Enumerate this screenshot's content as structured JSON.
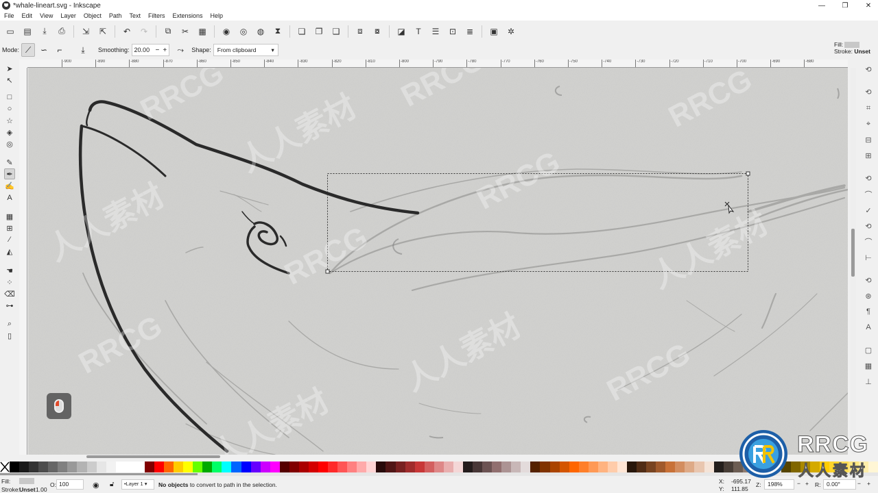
{
  "window": {
    "title": "*whale-lineart.svg - Inkscape",
    "min": "—",
    "max": "❐",
    "close": "✕"
  },
  "menu": [
    "File",
    "Edit",
    "View",
    "Layer",
    "Object",
    "Path",
    "Text",
    "Filters",
    "Extensions",
    "Help"
  ],
  "tool_controls": {
    "mode_label": "Mode:",
    "smoothing_label": "Smoothing:",
    "smoothing_value": "20.00",
    "shape_label": "Shape:",
    "shape_value": "From clipboard"
  },
  "fill_stroke_top": {
    "fill_label": "Fill:",
    "stroke_label": "Stroke:",
    "stroke_value": "Unset",
    "fill_color": "#c8c8c8"
  },
  "ruler": {
    "ticks": [
      "-900",
      "-890",
      "-880",
      "-870",
      "-860",
      "-850",
      "-840",
      "-830",
      "-820",
      "-810",
      "-800",
      "-790",
      "-780",
      "-770",
      "-760",
      "-750",
      "-740",
      "-730",
      "-720",
      "-710",
      "-700",
      "-690",
      "-680"
    ]
  },
  "status": {
    "fill_label": "Fill:",
    "stroke_label": "Stroke:",
    "stroke_value": "Unset",
    "stroke_width": "1.00",
    "opacity_label": "O:",
    "opacity_value": "100",
    "layer": "•Layer 1",
    "message_bold": "No objects",
    "message_rest": " to convert to path in the selection.",
    "x_label": "X:",
    "x_value": "-695.17",
    "y_label": "Y:",
    "y_value": "111.85",
    "zoom_label": "Z:",
    "zoom_value": "198%",
    "rotation_label": "R:",
    "rotation_value": "0.00°"
  },
  "watermark": {
    "text": "RRCG",
    "cn": "人人素材",
    "logo_text": "RRCG",
    "logo_cn": "人人素材"
  },
  "palette": [
    "#000000",
    "#1a1a1a",
    "#333333",
    "#4d4d4d",
    "#666666",
    "#808080",
    "#999999",
    "#b3b3b3",
    "#cccccc",
    "#e6e6e6",
    "#f2f2f2",
    "#ffffff",
    "#ffffff",
    "#ffffff",
    "#800000",
    "#ff0000",
    "#ff6600",
    "#ffcc00",
    "#ffff00",
    "#66ff00",
    "#00aa00",
    "#00ff66",
    "#00ffff",
    "#0066ff",
    "#0000ff",
    "#6600ff",
    "#cc00ff",
    "#ff00ff",
    "#550000",
    "#800000",
    "#aa0000",
    "#d40000",
    "#ff0000",
    "#ff2a2a",
    "#ff5555",
    "#ff8080",
    "#ffaaaa",
    "#ffd5d5",
    "#280b0b",
    "#501616",
    "#782121",
    "#a02c2c",
    "#c83737",
    "#d35f5f",
    "#de8787",
    "#e9afaf",
    "#f4d7d7",
    "#241c1c",
    "#483737",
    "#6c5353",
    "#916f6f",
    "#ac9393",
    "#c8b7b7",
    "#e3dbdb",
    "#552200",
    "#803300",
    "#aa4400",
    "#d45500",
    "#ff6600",
    "#ff7f2a",
    "#ff9955",
    "#ffb380",
    "#ffccaa",
    "#ffe6d5",
    "#28170b",
    "#502d16",
    "#784421",
    "#a05a2c",
    "#c87137",
    "#d38d5f",
    "#deaa87",
    "#e9c6af",
    "#f4e3d7",
    "#241f1c",
    "#483e37",
    "#6c5d53",
    "#917c6f",
    "#ac9d93",
    "#c8beb7",
    "#e3dedb",
    "#554400",
    "#806600",
    "#aa8800",
    "#d4aa00",
    "#ffcc00",
    "#ffd42a",
    "#ffdd55",
    "#ffe680",
    "#ffeeaa",
    "#fff6d5"
  ]
}
